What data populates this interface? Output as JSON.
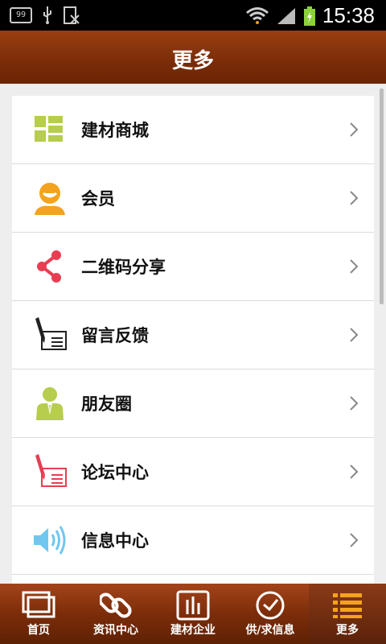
{
  "status_bar": {
    "badge": "99",
    "time": "15:38"
  },
  "header": {
    "title": "更多"
  },
  "menu": {
    "items": [
      {
        "label": "建材商城"
      },
      {
        "label": "会员"
      },
      {
        "label": "二维码分享"
      },
      {
        "label": "留言反馈"
      },
      {
        "label": "朋友圈"
      },
      {
        "label": "论坛中心"
      },
      {
        "label": "信息中心"
      }
    ]
  },
  "tabbar": {
    "items": [
      {
        "label": "首页"
      },
      {
        "label": "资讯中心"
      },
      {
        "label": "建材企业"
      },
      {
        "label": "供/求信息"
      },
      {
        "label": "更多"
      }
    ],
    "active_index": 4
  },
  "colors": {
    "header_brown": "#7a2c08",
    "green_icon": "#b6cd4d",
    "orange_icon": "#f3a31d",
    "red_icon": "#e93d52",
    "blue_icon": "#6fc7ef"
  }
}
